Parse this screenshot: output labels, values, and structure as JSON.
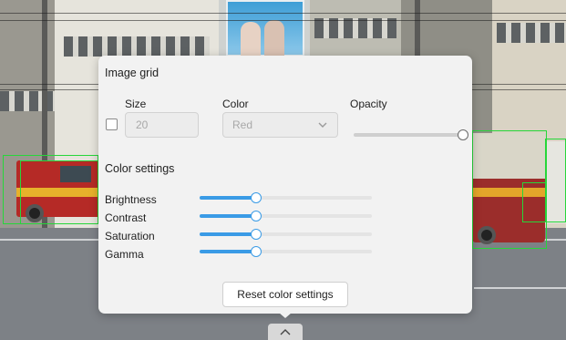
{
  "image_grid": {
    "title": "Image grid",
    "enabled": false,
    "size_label": "Size",
    "size_value": "20",
    "color_label": "Color",
    "color_value": "Red",
    "opacity_label": "Opacity",
    "opacity_value": 1.0
  },
  "color_settings": {
    "title": "Color settings",
    "sliders": [
      {
        "label": "Brightness",
        "value": 0.33
      },
      {
        "label": "Contrast",
        "value": 0.33
      },
      {
        "label": "Saturation",
        "value": 0.33
      },
      {
        "label": "Gamma",
        "value": 0.33
      }
    ],
    "reset_label": "Reset color settings"
  },
  "colors": {
    "accent": "#3a9be6",
    "panel_bg": "#f2f2f2",
    "bounding_box": "#27d63a"
  },
  "icons": {
    "select": "chevron-down-icon",
    "toggle": "chevron-up-icon"
  }
}
